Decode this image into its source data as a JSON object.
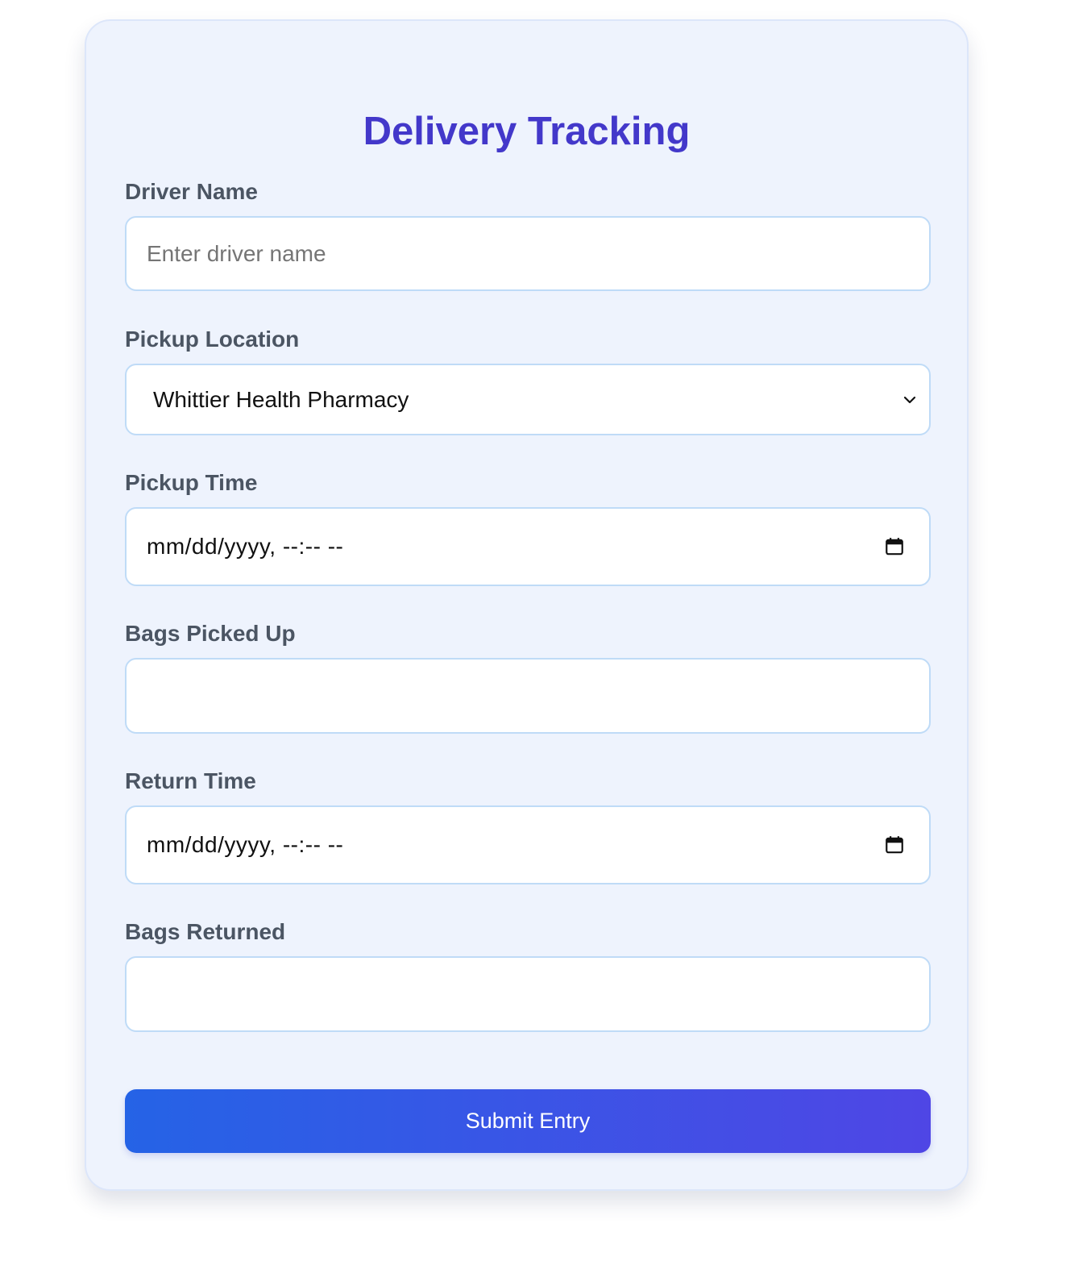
{
  "form": {
    "title": "Delivery Tracking",
    "driver_name": {
      "label": "Driver Name",
      "value": "",
      "placeholder": "Enter driver name"
    },
    "pickup_location": {
      "label": "Pickup Location",
      "selected": "Whittier Health Pharmacy"
    },
    "pickup_time": {
      "label": "Pickup Time",
      "display": "mm/dd/yyyy, --:-- --"
    },
    "bags_picked_up": {
      "label": "Bags Picked Up",
      "value": ""
    },
    "return_time": {
      "label": "Return Time",
      "display": "mm/dd/yyyy, --:-- --"
    },
    "bags_returned": {
      "label": "Bags Returned",
      "value": ""
    },
    "submit_label": "Submit Entry"
  },
  "icons": {
    "select_arrow": "chevron-down-icon",
    "datetime_picker": "calendar-icon"
  },
  "colors": {
    "title": "#4338ca",
    "card_background": "#eef3fd",
    "field_border": "#bfdbf7",
    "label": "#4b5563",
    "button_gradient_start": "#2563e6",
    "button_gradient_end": "#4f46e5"
  }
}
